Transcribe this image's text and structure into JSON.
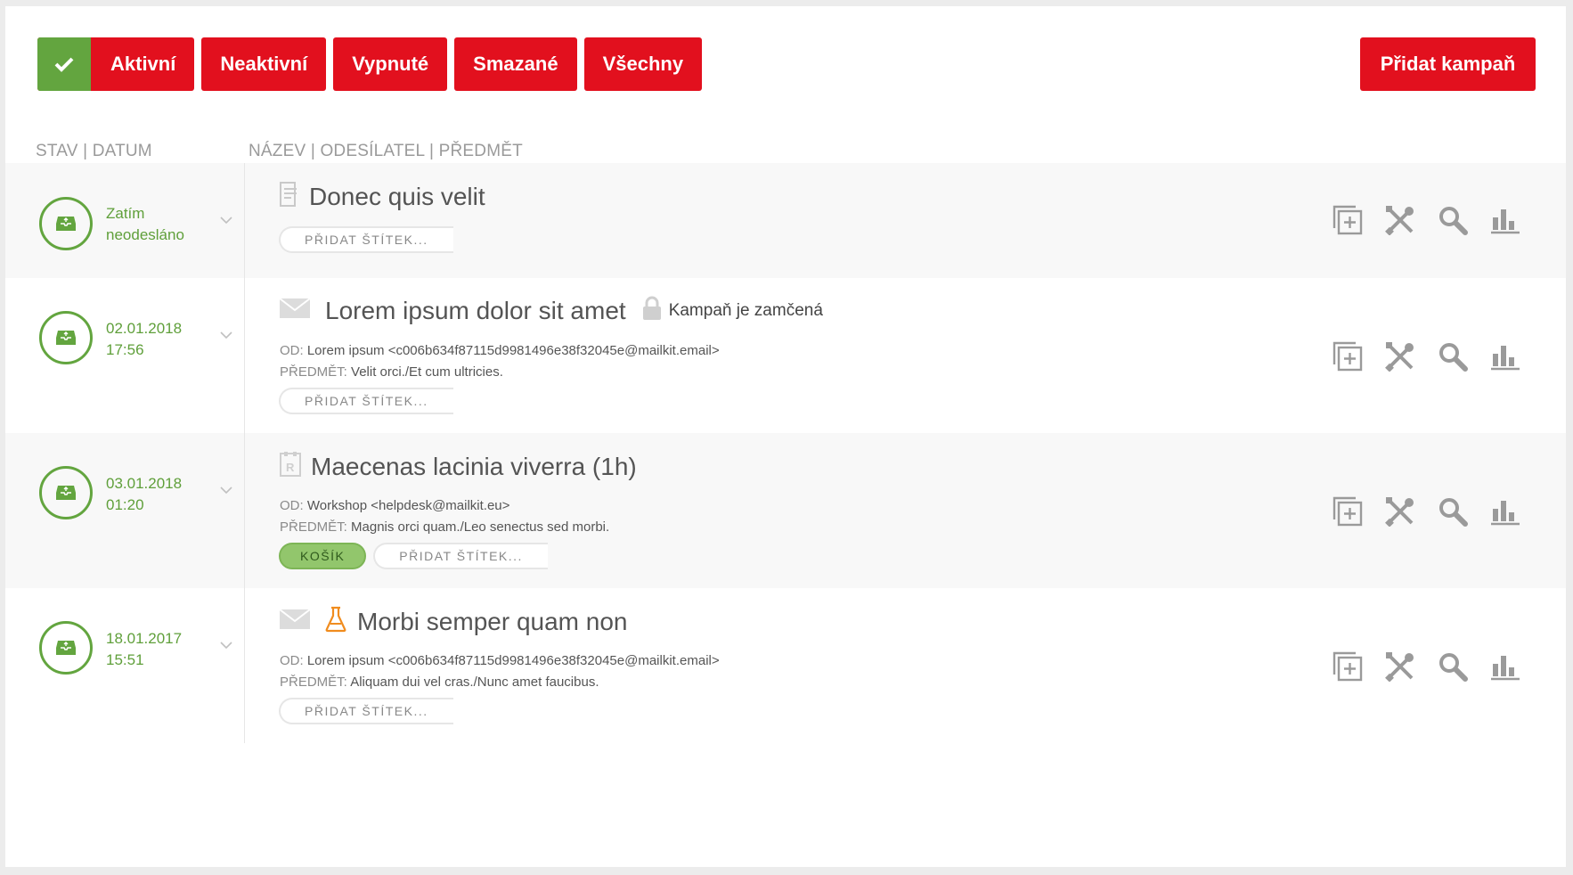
{
  "filters": {
    "active_label": "Aktivní",
    "inactive_label": "Neaktivní",
    "disabled_label": "Vypnuté",
    "deleted_label": "Smazané",
    "all_label": "Všechny",
    "add_campaign_label": "Přidat kampaň"
  },
  "headers": {
    "left": "STAV | DATUM",
    "right": "NÁZEV | ODESÍLATEL | PŘEDMĚT"
  },
  "colors": {
    "brand_red": "#e2101e",
    "active_green": "#63a53f",
    "tag_green": "#92c66c"
  },
  "campaigns": [
    {
      "status_line1": "Zatím",
      "status_line2": "neodesláno",
      "type_icon": "document-icon",
      "title": "Donec quis velit",
      "tag_add_label": "PŘIDAT ŠTÍTEK..."
    },
    {
      "status_line1": "02.01.2018",
      "status_line2": "17:56",
      "type_icon": "envelope-icon",
      "title": "Lorem ipsum dolor sit amet",
      "lock_text": "Kampaň je zamčená",
      "from_key": "OD:",
      "from_value": "Lorem ipsum <c006b634f87115d9981496e38f32045e@mailkit.email>",
      "subject_key": "PŘEDMĚT:",
      "subject_value": "Velit orci./Et cum ultricies.",
      "tag_add_label": "PŘIDAT ŠTÍTEK..."
    },
    {
      "status_line1": "03.01.2018",
      "status_line2": "01:20",
      "type_icon": "recurring-icon",
      "title": "Maecenas lacinia viverra (1h)",
      "from_key": "OD:",
      "from_value": "Workshop <helpdesk@mailkit.eu>",
      "subject_key": "PŘEDMĚT:",
      "subject_value": "Magnis orci quam./Leo senectus sed morbi.",
      "tag_label": "KOŠÍK",
      "tag_add_label": "PŘIDAT ŠTÍTEK..."
    },
    {
      "status_line1": "18.01.2017",
      "status_line2": "15:51",
      "type_icon": "envelope-icon",
      "title": "Morbi semper quam non",
      "from_key": "OD:",
      "from_value": "Lorem ipsum <c006b634f87115d9981496e38f32045e@mailkit.email>",
      "subject_key": "PŘEDMĚT:",
      "subject_value": "Aliquam dui vel cras./Nunc amet faucibus.",
      "tag_add_label": "PŘIDAT ŠTÍTEK..."
    }
  ]
}
